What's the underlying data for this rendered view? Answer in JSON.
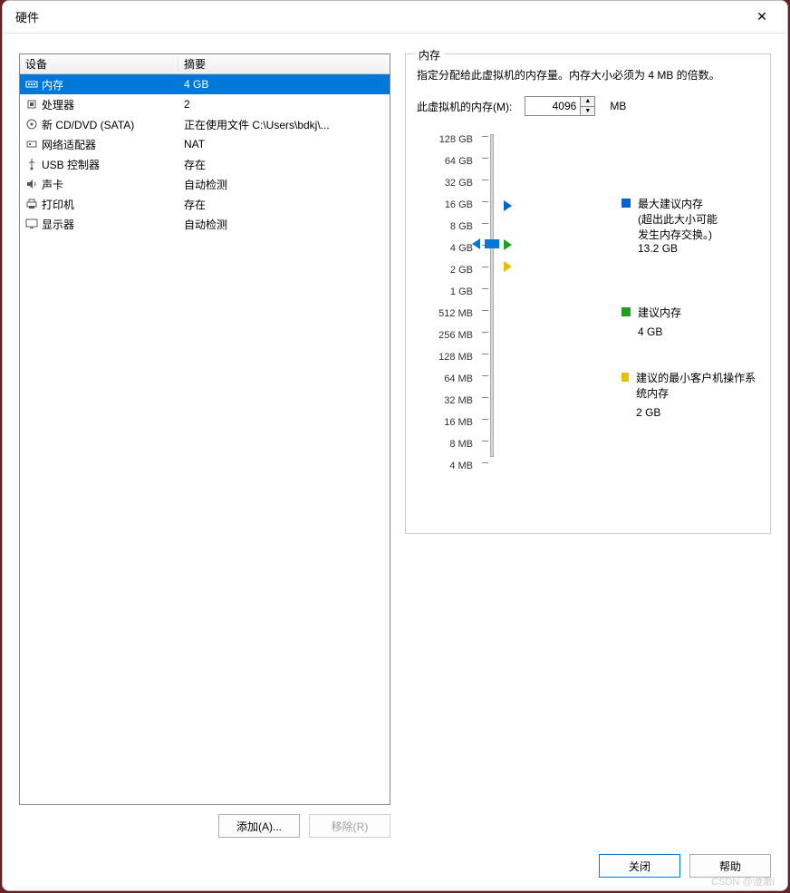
{
  "title": "硬件",
  "table": {
    "col1": "设备",
    "col2": "摘要",
    "rows": [
      {
        "icon": "memory-icon",
        "name": "内存",
        "summary": "4 GB",
        "selected": true
      },
      {
        "icon": "cpu-icon",
        "name": "处理器",
        "summary": "2"
      },
      {
        "icon": "disc-icon",
        "name": "新 CD/DVD (SATA)",
        "summary": "正在使用文件 C:\\Users\\bdkj\\..."
      },
      {
        "icon": "nic-icon",
        "name": "网络适配器",
        "summary": "NAT"
      },
      {
        "icon": "usb-icon",
        "name": "USB 控制器",
        "summary": "存在"
      },
      {
        "icon": "sound-icon",
        "name": "声卡",
        "summary": "自动检测"
      },
      {
        "icon": "printer-icon",
        "name": "打印机",
        "summary": "存在"
      },
      {
        "icon": "display-icon",
        "name": "显示器",
        "summary": "自动检测"
      }
    ]
  },
  "left_buttons": {
    "add": "添加(A)...",
    "remove": "移除(R)"
  },
  "panel": {
    "legend": "内存",
    "desc": "指定分配给此虚拟机的内存量。内存大小必须为 4 MB 的倍数。",
    "mem_label": "此虚拟机的内存(M):",
    "mem_value": "4096",
    "unit": "MB",
    "ticks": [
      "128 GB",
      "64 GB",
      "32 GB",
      "16 GB",
      "8 GB",
      "4 GB",
      "2 GB",
      "1 GB",
      "512 MB",
      "256 MB",
      "128 MB",
      "64 MB",
      "32 MB",
      "16 MB",
      "8 MB",
      "4 MB"
    ],
    "legend_max": {
      "title": "最大建议内存",
      "sub1": "(超出此大小可能",
      "sub2": "发生内存交换。)",
      "value": "13.2 GB",
      "color": "#0066cc"
    },
    "legend_rec": {
      "title": "建议内存",
      "value": "4 GB",
      "color": "#1fa01f"
    },
    "legend_min": {
      "title": "建议的最小客户机操作系统内存",
      "value": "2 GB",
      "color": "#e6c000"
    }
  },
  "footer": {
    "close": "关闭",
    "help": "帮助"
  },
  "watermark": "CSDN @澄澈i"
}
